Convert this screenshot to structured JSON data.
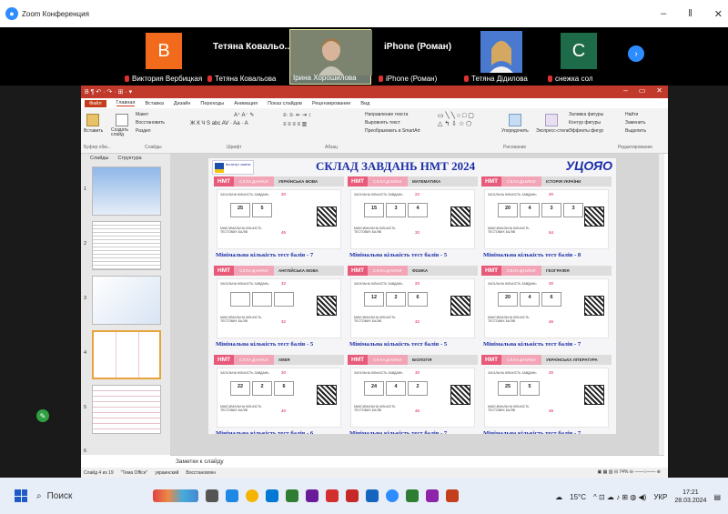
{
  "window": {
    "title": "Zoom Конференция",
    "minimize": "–",
    "restore": "ǁ",
    "close": "✕"
  },
  "participants": [
    {
      "name": "Виктория Вербицкая",
      "avatar": "В",
      "color": "#f26b1d",
      "kind": "avatar"
    },
    {
      "name": "Тетяна Ковальова",
      "display": "Тетяна Ковальо...",
      "kind": "text"
    },
    {
      "name": "Ірина Хорошилова",
      "kind": "video"
    },
    {
      "name": "iPhone (Роман)",
      "display": "iPhone (Роман)",
      "kind": "text"
    },
    {
      "name": "Тетяна Дідилова",
      "kind": "video2"
    },
    {
      "name": "снежка сол",
      "avatar": "С",
      "color": "#1e6b4a",
      "kind": "avatar"
    }
  ],
  "ppt": {
    "qat": "В ¶ ↶ · ↷ · ⊞ · ▾",
    "tabs": [
      "Файл",
      "Главная",
      "Вставка",
      "Дизайн",
      "Переходы",
      "Анимация",
      "Показ слайдов",
      "Рецензирование",
      "Вид"
    ],
    "ribbon": {
      "paste": "Вставить",
      "create_slide": "Создать слайд",
      "layout": "Макет",
      "restore": "Восстановить",
      "section": "Раздел",
      "text_direction": "Направление текста",
      "align_text": "Выровнять текст",
      "to_smartart": "Преобразовать в SmartArt",
      "arrange": "Упорядочить",
      "quick_styles": "Экспресс-стили",
      "fill": "Заливка фигуры",
      "outline": "Контур фигуры",
      "effects": "Эффекты фигур",
      "find": "Найти",
      "replace": "Заменить",
      "select": "Выделить",
      "groups": [
        "Буфер обм...",
        "Слайды",
        "Шрифт",
        "Абзац",
        "Рисование",
        "Редактирование"
      ]
    },
    "pane_tabs": [
      "Слайды",
      "Структура"
    ],
    "thumb_numbers": [
      "1",
      "2",
      "3",
      "4",
      "5",
      "6"
    ],
    "notes_placeholder": "Заметки к слайду",
    "status": [
      "Слайд 4 из 19",
      "\"Тема Office\"",
      "украинский",
      "Восстановлен"
    ],
    "zoom": "74%"
  },
  "slide": {
    "title": "СКЛАД ЗАВДАНЬ НМТ 2024",
    "brand": "УЦОЯО",
    "institute": "Інститут освіти",
    "nmt": "НМТ",
    "sklad": "СКЛАДНИКИ",
    "total_label": "ЗАГАЛЬНА КІЛЬКІСТЬ ЗАВДАНЬ",
    "max_label": "МАКСИМАЛЬНА КІЛЬКІСТЬ ТЕСТОВИХ БАЛІВ",
    "cards": [
      {
        "subject": "УКРАЇНСЬКА МОВА",
        "total": "30",
        "boxes": [
          "25",
          "5"
        ],
        "max": "45",
        "min": "Мінімальна кількість тест балів - 7"
      },
      {
        "subject": "МАТЕМАТИКА",
        "total": "22",
        "boxes": [
          "15",
          "3",
          "4"
        ],
        "max": "32",
        "min": "Мінімальна кількість тест балів - 5"
      },
      {
        "subject": "ІСТОРІЯ УКРАЇНИ",
        "total": "30",
        "boxes": [
          "20",
          "4",
          "3",
          "3"
        ],
        "max": "54",
        "min": "Мінімальна кількість тест балів - 8"
      },
      {
        "subject": "АНГЛІЙСЬКА МОВА",
        "total": "32",
        "boxes": [
          "",
          "",
          ""
        ],
        "max": "32",
        "min": "Мінімальна кількість тест балів - 5"
      },
      {
        "subject": "ФІЗИКА",
        "total": "20",
        "boxes": [
          "12",
          "2",
          "6"
        ],
        "max": "32",
        "min": "Мінімальна кількість тест балів - 5"
      },
      {
        "subject": "ГЕОГРАФІЯ",
        "total": "30",
        "boxes": [
          "20",
          "4",
          "6"
        ],
        "max": "46",
        "min": "Мінімальна кількість тест балів - 7"
      },
      {
        "subject": "ХІМІЯ",
        "total": "30",
        "boxes": [
          "22",
          "2",
          "6"
        ],
        "max": "40",
        "min": "Мінімальна кількість тест балів - 6"
      },
      {
        "subject": "БІОЛОГІЯ",
        "total": "30",
        "boxes": [
          "24",
          "4",
          "2"
        ],
        "max": "46",
        "min": "Мінімальна кількість тест балів - 7"
      },
      {
        "subject": "УКРАЇНСЬКА ЛІТЕРАТУРА",
        "total": "30",
        "boxes": [
          "25",
          "5"
        ],
        "max": "45",
        "min": "Мінімальна кількість тест балів - 7"
      }
    ]
  },
  "taskbar": {
    "search": "Поиск",
    "weather": "15°C",
    "lang": "УКР",
    "time": "17:21",
    "date": "28.03.2024"
  }
}
